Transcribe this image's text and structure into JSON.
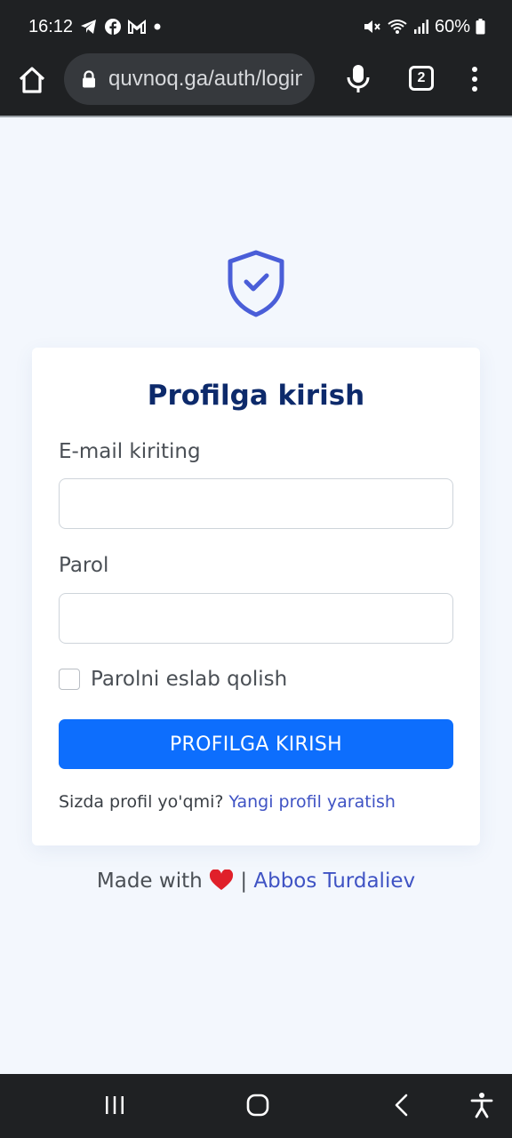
{
  "status_bar": {
    "time": "16:12",
    "battery": "60%",
    "icons": [
      "telegram-icon",
      "facebook-icon",
      "gmail-icon",
      "dot-icon",
      "mute-icon",
      "wifi-icon",
      "signal-icon",
      "battery-icon"
    ]
  },
  "browser": {
    "url": "quvnoq.ga/auth/login",
    "tab_count": "2"
  },
  "login": {
    "title": "Profilga kirish",
    "email_label": "E-mail kiriting",
    "email_value": "",
    "password_label": "Parol",
    "password_value": "",
    "remember_label": "Parolni eslab qolish",
    "remember_checked": false,
    "submit_label": "PROFILGA KIRISH",
    "signup_prompt": "Sizda profil yo'qmi?",
    "signup_link": "Yangi profil yaratish"
  },
  "footer": {
    "made_with": "Made with",
    "separator": "|",
    "author": "Abbos Turdaliev"
  },
  "colors": {
    "primary": "#0d6efd",
    "title": "#0d2a6b",
    "link": "#3f53c4",
    "shield": "#4a5ed8",
    "background": "#f3f7fd",
    "system_bar": "#1f2123",
    "heart": "#e0202a"
  }
}
